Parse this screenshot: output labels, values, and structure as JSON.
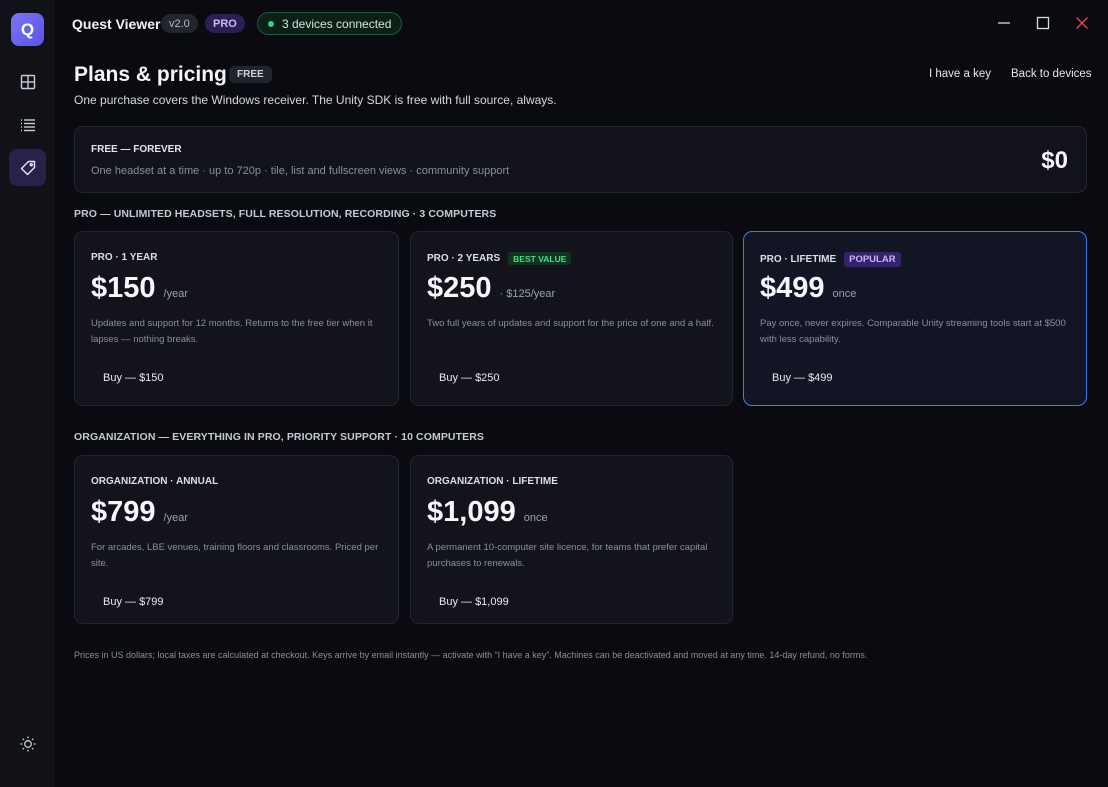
{
  "app": {
    "logo_letter": "Q",
    "title": "Quest Viewer",
    "version": "v2.0",
    "plan_badge": "PRO",
    "devices_status": "3 devices connected"
  },
  "sidebar": {
    "items": [
      {
        "name": "grid-icon",
        "active": false
      },
      {
        "name": "list-icon",
        "active": false
      },
      {
        "name": "tag-icon",
        "active": true
      }
    ],
    "bottom_icon": "sun-icon"
  },
  "header": {
    "title": "Plans & pricing",
    "badge": "FREE",
    "subtitle": "One purchase covers the Windows receiver. The Unity SDK is free with full source, always.",
    "have_key": "I have a key",
    "back": "Back to devices"
  },
  "free_plan": {
    "title": "FREE — FOREVER",
    "description": "One headset at a time · up to 720p · tile, list and fullscreen views · community support",
    "price": "$0"
  },
  "pro_section": {
    "label": "PRO — UNLIMITED HEADSETS, FULL RESOLUTION, RECORDING · 3 COMPUTERS",
    "cards": [
      {
        "title": "PRO · 1 YEAR",
        "tag": "",
        "price": "$150",
        "unit": "/year",
        "description": "Updates and support for 12 months. Returns to the free tier when it lapses — nothing breaks.",
        "buy": "Buy — $150"
      },
      {
        "title": "PRO · 2 YEARS",
        "tag": "BEST VALUE",
        "price": "$250",
        "unit": "· $125/year",
        "description": "Two full years of updates and support for the price of one and a half.",
        "buy": "Buy — $250"
      },
      {
        "title": "PRO · LIFETIME",
        "tag": "POPULAR",
        "price": "$499",
        "unit": "once",
        "description": "Pay once, never expires. Comparable Unity streaming tools start at $500 with less capability.",
        "buy": "Buy — $499"
      }
    ]
  },
  "org_section": {
    "label": "ORGANIZATION — EVERYTHING IN PRO, PRIORITY SUPPORT · 10 COMPUTERS",
    "cards": [
      {
        "title": "ORGANIZATION · ANNUAL",
        "price": "$799",
        "unit": "/year",
        "description": "For arcades, LBE venues, training floors and classrooms. Priced per site.",
        "buy": "Buy — $799"
      },
      {
        "title": "ORGANIZATION · LIFETIME",
        "price": "$1,099",
        "unit": "once",
        "description": "A permanent 10-computer site licence, for teams that prefer capital purchases to renewals.",
        "buy": "Buy — $1,099"
      }
    ]
  },
  "footnote": "Prices in US dollars; local taxes are calculated at checkout. Keys arrive by email instantly — activate with “I have a key”. Machines can be deactivated and moved at any time. 14-day refund, no forms.",
  "colors": {
    "accent": "#6c63f0",
    "popular_border": "#3d7ee6",
    "connected": "#2fd27a",
    "close": "#e0444e"
  }
}
